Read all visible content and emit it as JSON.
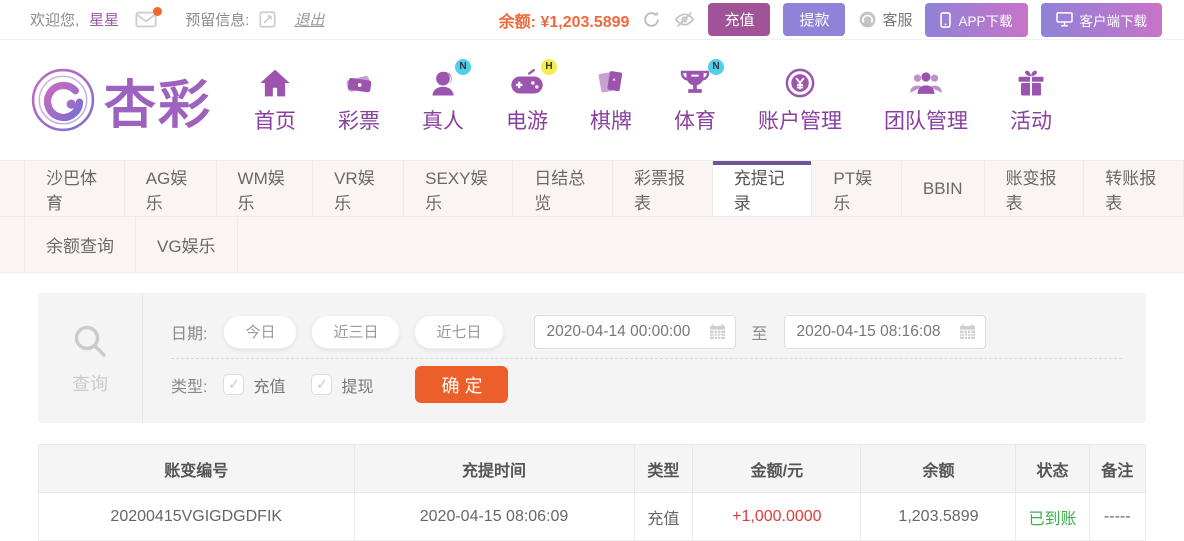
{
  "topbar": {
    "welcome_prefix": "欢迎您,",
    "username": "星星",
    "reserved_info_label": "预留信息:",
    "logout_label": "退出",
    "balance_label": "余额:",
    "balance_value": "¥1,203.5899",
    "deposit_button": "充值",
    "withdraw_button": "提款",
    "service_label": "客服",
    "app_download_button": "APP下载",
    "client_download_button": "客户端下载"
  },
  "brand": {
    "name": "杏彩"
  },
  "nav": {
    "items": [
      {
        "label": "首页",
        "icon": "home-icon",
        "badge": ""
      },
      {
        "label": "彩票",
        "icon": "lottery-ticket-icon",
        "badge": ""
      },
      {
        "label": "真人",
        "icon": "live-dealer-icon",
        "badge": "N",
        "badge_color": "#4fd0e8"
      },
      {
        "label": "电游",
        "icon": "egames-gamepad-icon",
        "badge": "H",
        "badge_color": "#f2ee4e"
      },
      {
        "label": "棋牌",
        "icon": "cards-icon",
        "badge": ""
      },
      {
        "label": "体育",
        "icon": "sports-trophy-icon",
        "badge": "N",
        "badge_color": "#4fd0e8"
      },
      {
        "label": "账户管理",
        "icon": "account-manage-icon",
        "badge": ""
      },
      {
        "label": "团队管理",
        "icon": "team-manage-icon",
        "badge": ""
      },
      {
        "label": "活动",
        "icon": "activity-gift-icon",
        "badge": ""
      }
    ]
  },
  "tabs": {
    "row1": [
      "沙巴体育",
      "AG娱乐",
      "WM娱乐",
      "VR娱乐",
      "SEXY娱乐",
      "日结总览",
      "彩票报表",
      "充提记录",
      "PT娱乐",
      "BBIN",
      "账变报表",
      "转账报表"
    ],
    "row2": [
      "余额查询",
      "VG娱乐"
    ],
    "active": "充提记录"
  },
  "filter": {
    "query_label": "查询",
    "date_label": "日期:",
    "quick_ranges": [
      "今日",
      "近三日",
      "近七日"
    ],
    "date_from": "2020-04-14 00:00:00",
    "to_label": "至",
    "date_to": "2020-04-15 08:16:08",
    "type_label": "类型:",
    "type_options": [
      "充值",
      "提现"
    ],
    "submit_button": "确 定"
  },
  "table": {
    "headers": [
      "账变编号",
      "充提时间",
      "类型",
      "金额/元",
      "余额",
      "状态",
      "备注"
    ],
    "rows": [
      {
        "id": "20200415VGIGDGDFIK",
        "time": "2020-04-15 08:06:09",
        "type": "充值",
        "amount": "+1,000.0000",
        "balance": "1,203.5899",
        "status": "已到账",
        "remark": "-----"
      }
    ]
  },
  "colors": {
    "accent_purple": "#6f5499",
    "nav_purple": "#8a3fa0",
    "deposit_button_bg": "#a1539a",
    "withdraw_button_bg": "#8f82d8",
    "download_gradient_start": "#8f82d8",
    "download_gradient_end": "#c873c8",
    "balance_orange": "#f0683c",
    "submit_orange": "#ed5f2a",
    "amount_red": "#e03a3a",
    "status_green": "#3faf4e",
    "badge_new_bg": "#4fd0e8",
    "badge_hot_bg": "#f2ee4e"
  }
}
